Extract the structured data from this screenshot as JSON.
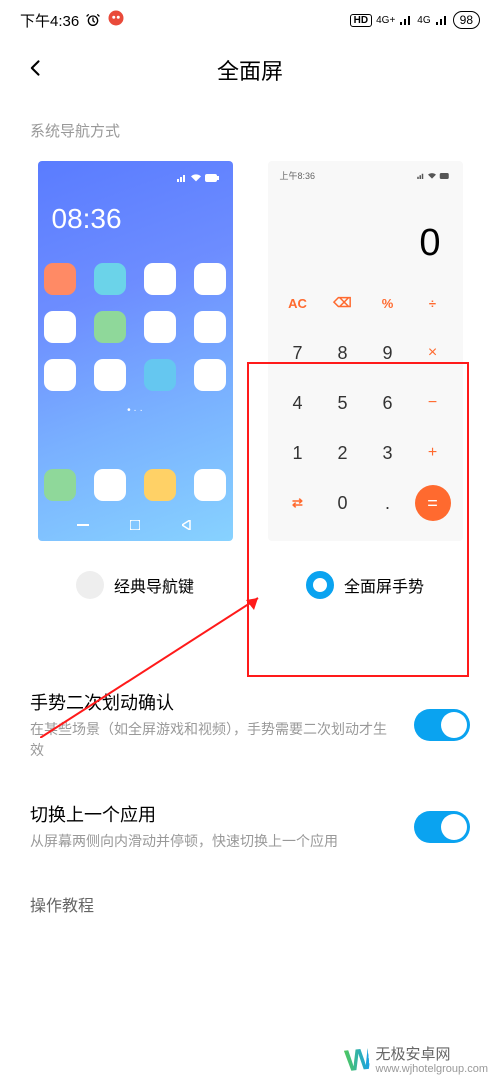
{
  "status_bar": {
    "time": "下午4:36",
    "battery": "98",
    "sim1_label": "4G+",
    "sim2_label": "4G",
    "hd_label": "HD"
  },
  "header": {
    "title": "全面屏"
  },
  "nav_mode_label": "系统导航方式",
  "options": {
    "classic": {
      "label": "经典导航键"
    },
    "gesture": {
      "label": "全面屏手势"
    }
  },
  "preview_home": {
    "clock": "08:36",
    "icon_colors": [
      "#ff8a65",
      "#6bd3e9",
      "#ffffff",
      "#ffffff",
      "#ffffff",
      "#8fd89a",
      "#ffffff",
      "#ffffff",
      "#ffffff",
      "#ffffff",
      "#65c7f0",
      "#ffffff"
    ],
    "dock_colors": [
      "#8fd89a",
      "#ffffff",
      "#ffd166",
      "#ffffff"
    ]
  },
  "preview_calc": {
    "status_time": "上午8:36",
    "display": "0",
    "rows": [
      [
        "AC",
        "⌫",
        "%",
        "÷"
      ],
      [
        "7",
        "8",
        "9",
        "×"
      ],
      [
        "4",
        "5",
        "6",
        "−"
      ],
      [
        "1",
        "2",
        "3",
        "+"
      ],
      [
        "⇄",
        "0",
        ".",
        "="
      ]
    ]
  },
  "settings": [
    {
      "title": "手势二次划动确认",
      "desc": "在某些场景（如全屏游戏和视频），手势需要二次划动才生效",
      "on": true
    },
    {
      "title": "切换上一个应用",
      "desc": "从屏幕两侧向内滑动并停顿，快速切换上一个应用",
      "on": true
    }
  ],
  "tutorial_label": "操作教程",
  "watermark": {
    "name": "无极安卓网",
    "url": "www.wjhotelgroup.com"
  }
}
